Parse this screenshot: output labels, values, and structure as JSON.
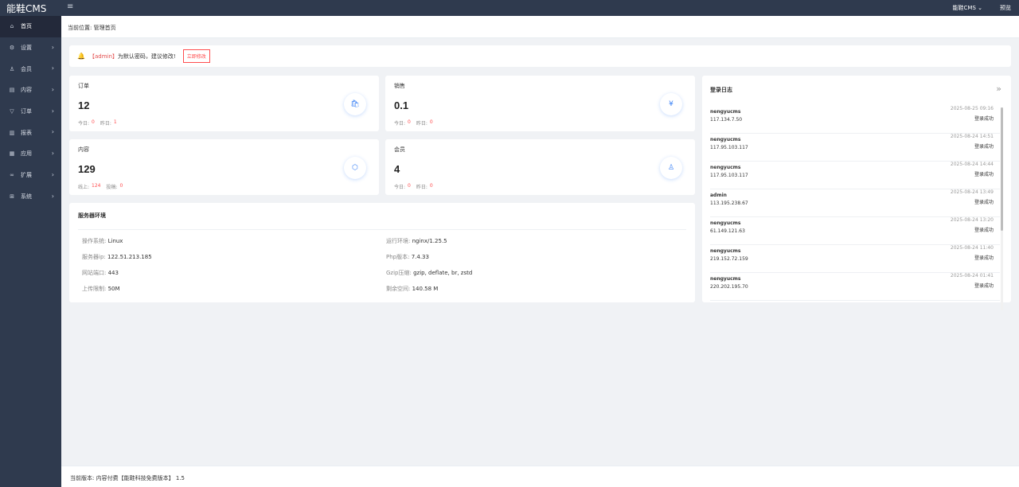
{
  "app": {
    "logo": "能鞋CMS",
    "menu_toggle": "≡"
  },
  "topbar": {
    "site_menu": "能鞋CMS",
    "preview": "预览"
  },
  "sidebar": {
    "items": [
      {
        "label": "首页",
        "icon": "home-icon",
        "glyph": "⌂",
        "active": true,
        "has_arrow": false
      },
      {
        "label": "设置",
        "icon": "gear-icon",
        "glyph": "⚙",
        "active": false,
        "has_arrow": true
      },
      {
        "label": "会员",
        "icon": "user-icon",
        "glyph": "♙",
        "active": false,
        "has_arrow": true
      },
      {
        "label": "内容",
        "icon": "document-icon",
        "glyph": "▤",
        "active": false,
        "has_arrow": true
      },
      {
        "label": "订单",
        "icon": "filter-icon",
        "glyph": "▽",
        "active": false,
        "has_arrow": true
      },
      {
        "label": "报表",
        "icon": "chart-icon",
        "glyph": "▥",
        "active": false,
        "has_arrow": true
      },
      {
        "label": "应用",
        "icon": "grid-icon",
        "glyph": "▦",
        "active": false,
        "has_arrow": true
      },
      {
        "label": "扩展",
        "icon": "link-icon",
        "glyph": "∞",
        "active": false,
        "has_arrow": true
      },
      {
        "label": "系统",
        "icon": "apps-icon",
        "glyph": "⊞",
        "active": false,
        "has_arrow": true
      }
    ]
  },
  "breadcrumb": {
    "label": "当前位置:",
    "current": "管理首页"
  },
  "notice": {
    "admin": "【admin】",
    "text": "为默认密码，建议修改!",
    "button": "立即修改"
  },
  "stats": [
    {
      "title": "订单",
      "value": "12",
      "sub1_label": "今日:",
      "sub1_value": "0",
      "sub2_label": "昨日:",
      "sub2_value": "1",
      "icon": "shopping-bag-icon",
      "glyph": "🛍"
    },
    {
      "title": "销售",
      "value": "0.1",
      "sub1_label": "今日:",
      "sub1_value": "0",
      "sub2_label": "昨日:",
      "sub2_value": "0",
      "icon": "yen-icon",
      "glyph": "¥"
    },
    {
      "title": "内容",
      "value": "129",
      "sub1_label": "线上:",
      "sub1_value": "124",
      "sub2_label": "投稿:",
      "sub2_value": "0",
      "icon": "cube-icon",
      "glyph": "⬡"
    },
    {
      "title": "会员",
      "value": "4",
      "sub1_label": "今日:",
      "sub1_value": "0",
      "sub2_label": "昨日:",
      "sub2_value": "0",
      "icon": "user-icon",
      "glyph": "♙"
    }
  ],
  "server": {
    "title": "服务器环境",
    "left": [
      {
        "label": "操作系统:",
        "value": "Linux"
      },
      {
        "label": "服务器ip:",
        "value": "122.51.213.185"
      },
      {
        "label": "网站端口:",
        "value": "443"
      },
      {
        "label": "上传限制:",
        "value": "50M"
      }
    ],
    "right": [
      {
        "label": "运行环境:",
        "value": "nginx/1.25.5"
      },
      {
        "label": "Php版本:",
        "value": "7.4.33"
      },
      {
        "label": "Gzip压缩:",
        "value": "gzip, deflate, br, zstd"
      },
      {
        "label": "剩余空间:",
        "value": "140.58 M"
      }
    ]
  },
  "login_log": {
    "title": "登录日志",
    "more": "»",
    "entries": [
      {
        "user": "nengyucms",
        "ip": "117.134.7.50",
        "time": "2025-08-25 09:16",
        "status": "登录成功"
      },
      {
        "user": "nengyucms",
        "ip": "117.95.103.117",
        "time": "2025-08-24 14:51",
        "status": "登录成功"
      },
      {
        "user": "nengyucms",
        "ip": "117.95.103.117",
        "time": "2025-08-24 14:44",
        "status": "登录成功"
      },
      {
        "user": "admin",
        "ip": "113.195.238.67",
        "time": "2025-08-24 13:49",
        "status": "登录成功"
      },
      {
        "user": "nengyucms",
        "ip": "61.149.121.63",
        "time": "2025-08-24 13:20",
        "status": "登录成功"
      },
      {
        "user": "nengyucms",
        "ip": "219.152.72.159",
        "time": "2025-08-24 11:40",
        "status": "登录成功"
      },
      {
        "user": "nengyucms",
        "ip": "220.202.195.70",
        "time": "2025-08-24 01:41",
        "status": "登录成功"
      }
    ]
  },
  "footer": {
    "label": "当前版本:",
    "version": "内容付费【能鞋科技免费版本】 1.5"
  },
  "colors": {
    "sidebar": "#2f3a4e",
    "accent": "#3b82f6",
    "danger": "#ff4d4f"
  }
}
